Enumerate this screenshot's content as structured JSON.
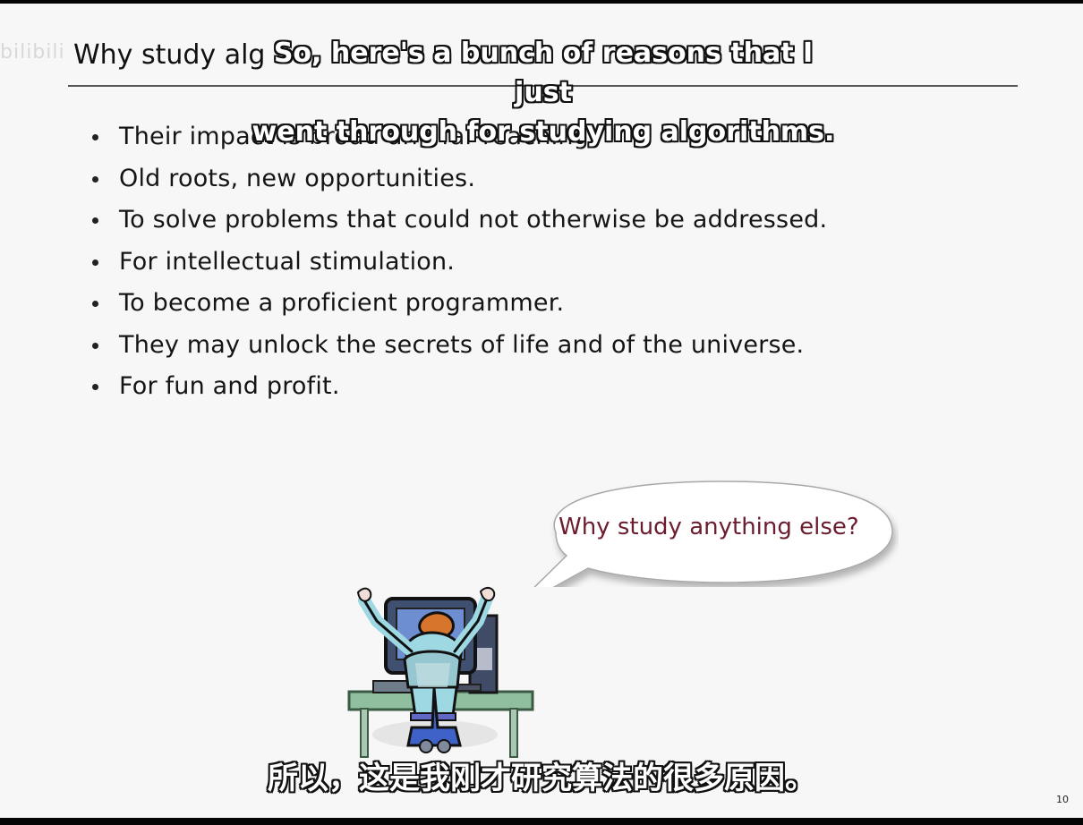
{
  "watermark": "bilibili",
  "slide": {
    "title": "Why study alg",
    "bullets": [
      "Their impact is broad and far-reaching.",
      "Old roots, new opportunities.",
      "To solve problems that could not otherwise be addressed.",
      "For intellectual stimulation.",
      "To become a proficient programmer.",
      "They may unlock the secrets of life and of the universe.",
      "For fun and profit."
    ],
    "speech_bubble": "Why study anything else?",
    "page_number": "10"
  },
  "subtitles": {
    "english": "So, here's a bunch of reasons that I just\nwent through for studying algorithms.",
    "chinese": "所以，这是我刚才研究算法的很多原因。"
  },
  "colors": {
    "slide_background": "#f7f7f7",
    "bubble_text": "#6b1d2e",
    "subtitle_fill": "#ffffff",
    "subtitle_outline": "#111111"
  },
  "icons": {
    "illustration": "programmer-at-computer-icon",
    "bubble": "speech-bubble-icon"
  }
}
